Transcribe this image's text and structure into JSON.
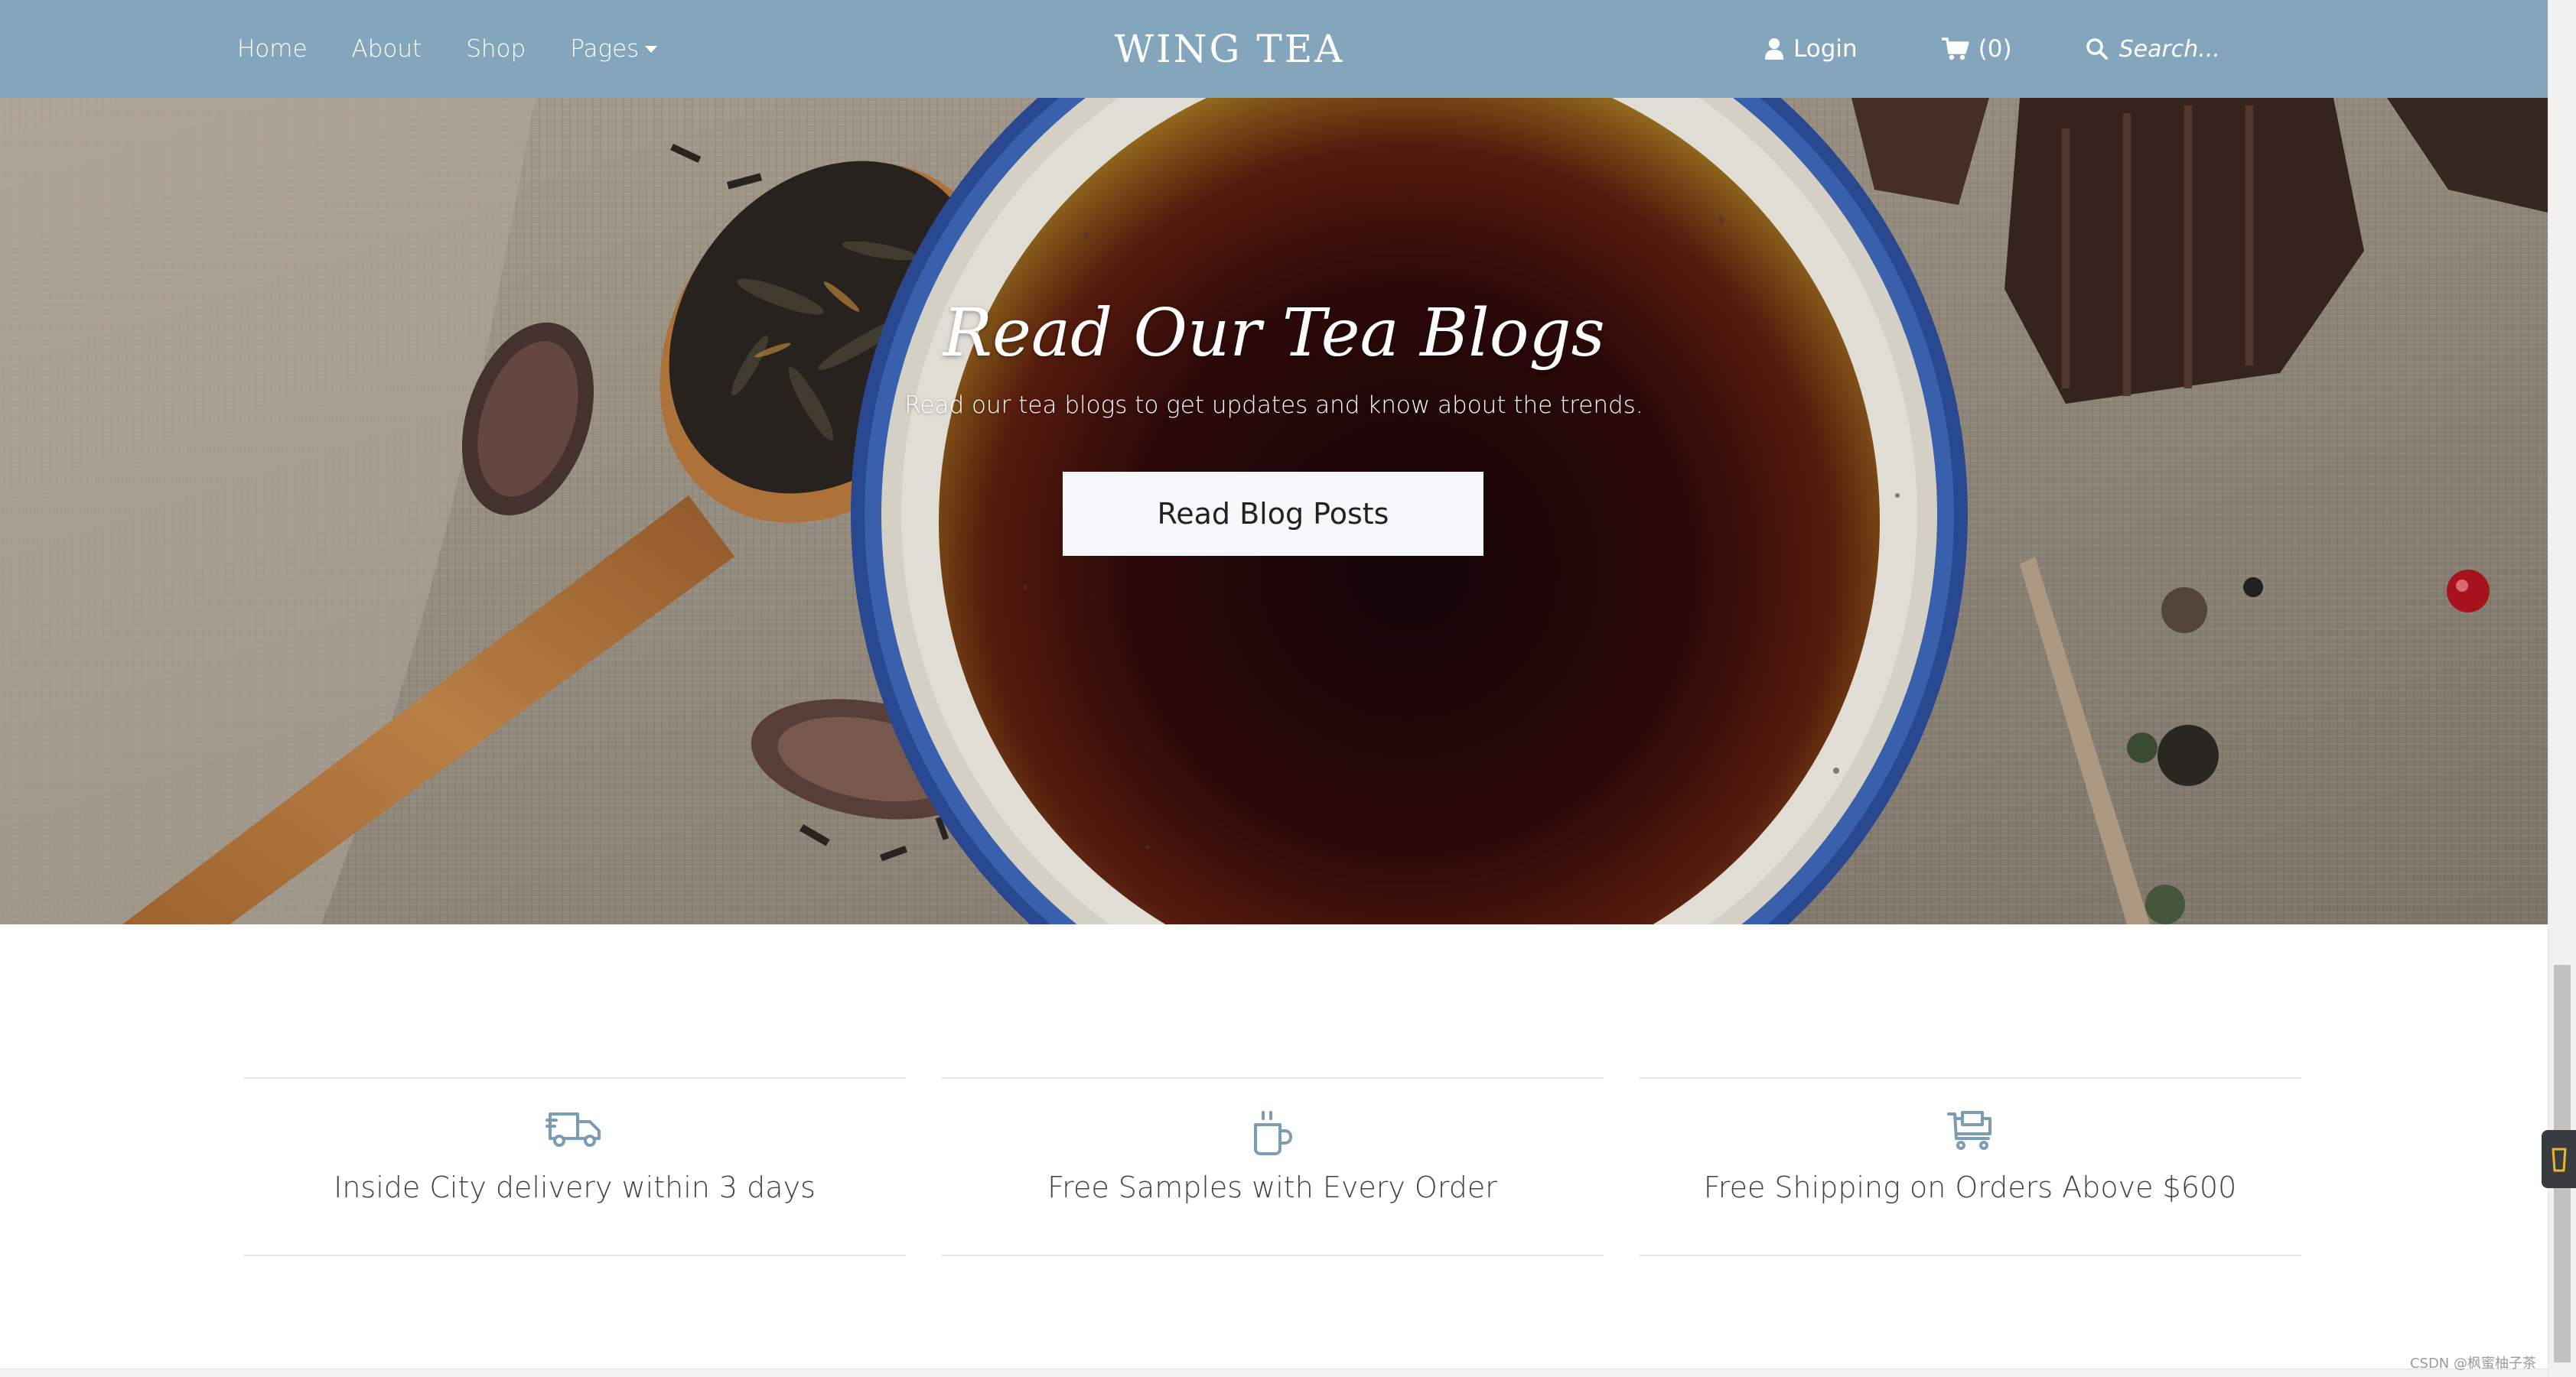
{
  "nav": {
    "links": [
      "Home",
      "About",
      "Shop",
      "Pages"
    ],
    "brand": "WING TEA",
    "login_label": "Login",
    "cart_count": "(0)",
    "search_placeholder": "Search..."
  },
  "hero": {
    "title": "Read Our Tea Blogs",
    "subtitle": "Read our tea blogs to get updates and know about the trends.",
    "button_label": "Read Blog Posts"
  },
  "features": [
    {
      "icon": "delivery-truck-icon",
      "text": "Inside City delivery within 3 days"
    },
    {
      "icon": "coffee-cup-icon",
      "text": "Free Samples with Every Order"
    },
    {
      "icon": "shopping-cart-icon",
      "text": "Free Shipping on Orders Above $600"
    }
  ],
  "watermark": "CSDN @枫蜜柚子茶",
  "colors": {
    "navbar": "#84a6bc",
    "icon_accent": "#7b9db3",
    "feature_text": "#3d4347",
    "divider": "#e8ebee"
  }
}
